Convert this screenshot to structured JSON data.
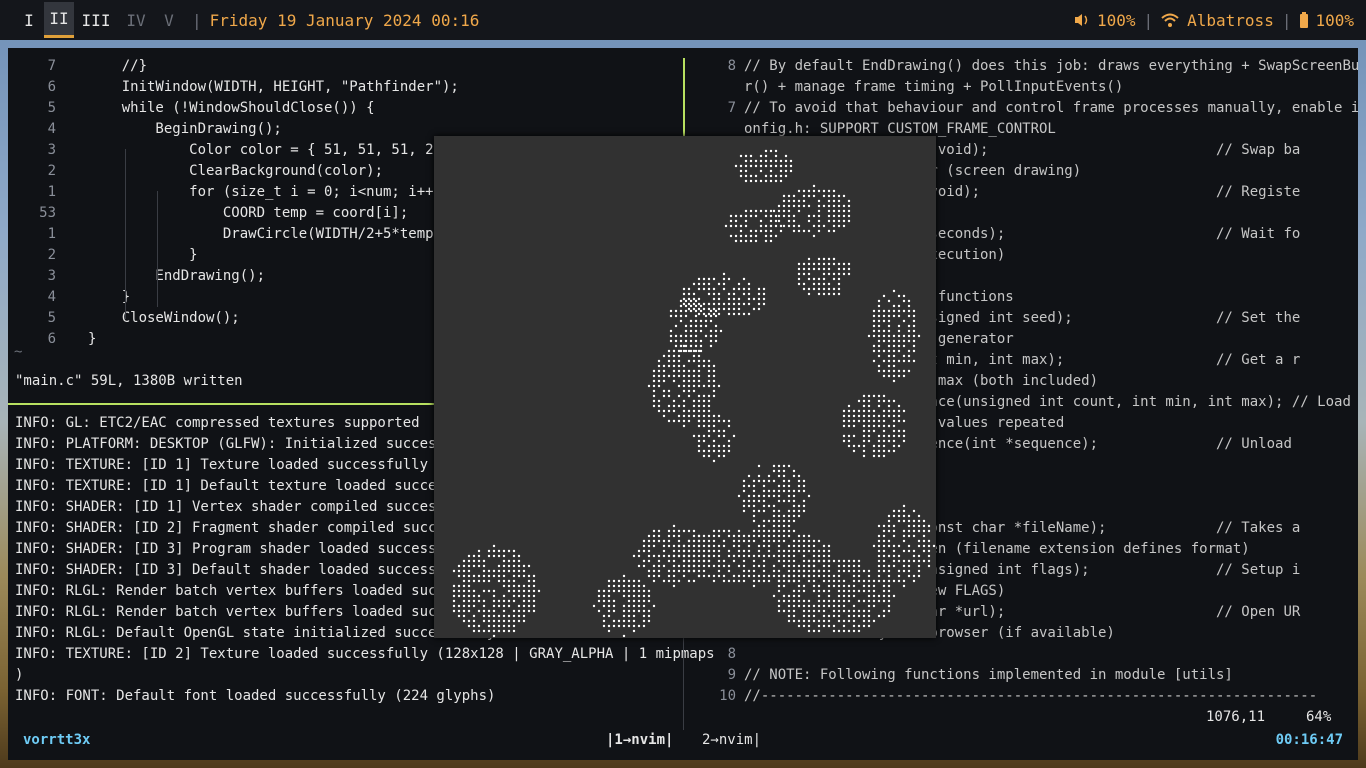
{
  "bar": {
    "workspaces": [
      {
        "label": "I",
        "state": "normal"
      },
      {
        "label": "II",
        "state": "active"
      },
      {
        "label": "III",
        "state": "normal"
      },
      {
        "label": "IV",
        "state": "dim"
      },
      {
        "label": "V",
        "state": "dim"
      }
    ],
    "separator": "|",
    "datetime": "Friday 19 January 2024 00:16",
    "volume": "100%",
    "wifi": "Albatross",
    "battery": "100%",
    "accent": "#f0a84a"
  },
  "left_code": [
    {
      "ln": "7",
      "code": "    //}"
    },
    {
      "ln": "6",
      "code": "    InitWindow(WIDTH, HEIGHT, \"Pathfinder\");"
    },
    {
      "ln": "5",
      "code": "    while (!WindowShouldClose()) {"
    },
    {
      "ln": "4",
      "code": "        BeginDrawing();"
    },
    {
      "ln": "3",
      "code": "            Color color = { 51, 51, 51, 255};"
    },
    {
      "ln": "2",
      "code": "            ClearBackground(color);"
    },
    {
      "ln": "1",
      "code": "            for (size_t i = 0; i<num; i++) {"
    },
    {
      "ln": "53",
      "code": "                COORD temp = coord[i];"
    },
    {
      "ln": "1",
      "code": "                DrawCircle(WIDTH/2+5*temp.x, HE"
    },
    {
      "ln": "2",
      "code": "            }"
    },
    {
      "ln": "3",
      "code": "        EndDrawing();"
    },
    {
      "ln": "4",
      "code": "    }"
    },
    {
      "ln": "5",
      "code": "    CloseWindow();"
    },
    {
      "ln": "6",
      "code": "}"
    }
  ],
  "tilde": "~",
  "written_msg": "\"main.c\" 59L, 1380B written",
  "log": [
    "INFO: GL: ETC2/EAC compressed textures supported",
    "INFO: PLATFORM: DESKTOP (GLFW): Initialized successfu",
    "INFO: TEXTURE: [ID 1] Texture loaded successfully (1x",
    "INFO: TEXTURE: [ID 1] Default texture loaded successf",
    "INFO: SHADER: [ID 1] Vertex shader compiled successfu",
    "INFO: SHADER: [ID 2] Fragment shader compiled success",
    "INFO: SHADER: [ID 3] Program shader loaded successful",
    "INFO: SHADER: [ID 3] Default shader loaded successful",
    "INFO: RLGL: Render batch vertex buffers loaded succes",
    "INFO: RLGL: Render batch vertex buffers loaded succes",
    "INFO: RLGL: Default OpenGL state initialized successfully",
    "INFO: TEXTURE: [ID 2] Texture loaded successfully (128x128 | GRAY_ALPHA | 1 mipmaps",
    ")",
    "INFO: FONT: Default font loaded successfully (224 glyphs)"
  ],
  "right_code": [
    {
      "ln": "8",
      "code": "// By default EndDrawing() does this job: draws everything + SwapScreenBuffe"
    },
    {
      "ln": "",
      "code": "r() + manage frame timing + PollInputEvents()"
    },
    {
      "ln": "7",
      "code": "// To avoid that behaviour and control frame processes manually, enable in c"
    },
    {
      "ln": "",
      "code": "onfig.h: SUPPORT_CUSTOM_FRAME_CONTROL"
    },
    {
      "ln": "",
      "code": "                   fer(void);                           // Swap ba"
    },
    {
      "ln": "",
      "code": "                   ffer (screen drawing)"
    },
    {
      "ln": "",
      "code": "                   ts(void);                            // Registe"
    },
    {
      "ln": "",
      "code": ""
    },
    {
      "ln": "",
      "code": "                   le seconds);                         // Wait fo"
    },
    {
      "ln": "",
      "code": "                   m execution)"
    },
    {
      "ln": "",
      "code": ""
    },
    {
      "ln": "",
      "code": "                   ion functions"
    },
    {
      "ln": "",
      "code": "                   (unsigned int seed);                 // Set the"
    },
    {
      "ln": "",
      "code": "                   ber generator"
    },
    {
      "ln": "",
      "code": "                   (int min, int max);                  // Get a r"
    },
    {
      "ln": "",
      "code": "                   and max (both included)"
    },
    {
      "ln": "",
      "code": "                   quence(unsigned int count, int min, int max); // Load"
    },
    {
      "ln": "",
      "code": "                    no values repeated"
    },
    {
      "ln": "",
      "code": "                   equence(int *sequence);              // Unload"
    },
    {
      "ln": "",
      "code": ""
    },
    {
      "ln": "",
      "code": ""
    },
    {
      "ln": "",
      "code": ""
    },
    {
      "ln": "",
      "code": "                   t(const char *fileName);             // Takes a"
    },
    {
      "ln": "",
      "code": "                   creen (filename extension defines format)"
    },
    {
      "ln": "",
      "code": "                   s(unsigned int flags);               // Setup i"
    },
    {
      "ln": "",
      "code": "                   (view FLAGS)"
    },
    {
      "ln": "",
      "code": "                    char *url);                         // Open UR"
    },
    {
      "ln": "",
      "code": "L with default system browser (if available)"
    },
    {
      "ln": "8",
      "code": ""
    },
    {
      "ln": "9",
      "code": "// NOTE: Following functions implemented in module [utils]"
    },
    {
      "ln": "10",
      "code": "//------------------------------------------------------------------"
    }
  ],
  "right_ruler": {
    "pos": "1076,11",
    "percent": "64%"
  },
  "tmux": {
    "session": "vorrtt3x",
    "win1": "|1→nvim|",
    "win2": "2→nvim|",
    "clock": "00:16:47"
  }
}
